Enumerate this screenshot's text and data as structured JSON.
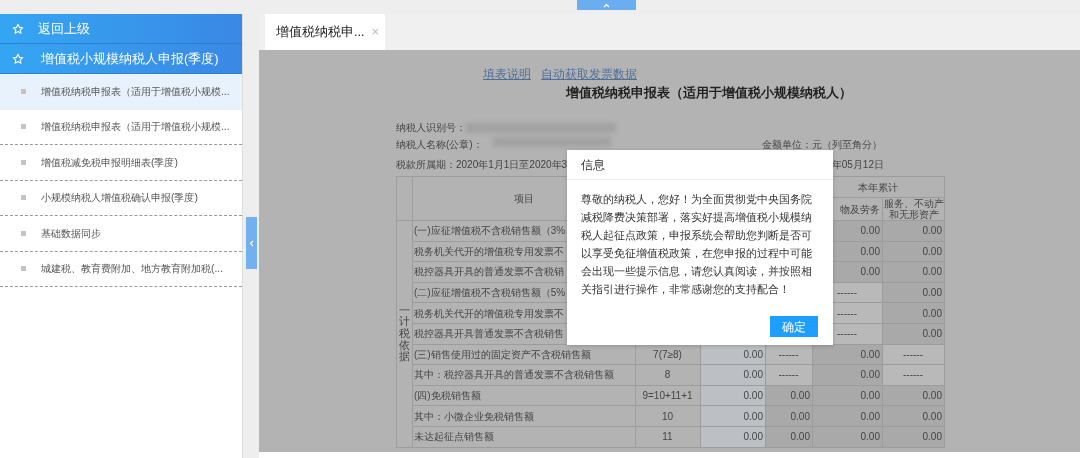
{
  "sidebar": {
    "header_items": [
      {
        "label": "返回上级"
      },
      {
        "label": "增值税小规模纳税人申报(季度)"
      }
    ],
    "items": [
      {
        "label": "增值税纳税申报表（适用于增值税小规模...",
        "selected": true
      },
      {
        "label": "增值税纳税申报表（适用于增值税小规模...",
        "selected": false
      },
      {
        "label": "增值税减免税申报明细表(季度)",
        "selected": false
      },
      {
        "label": "小规模纳税人增值税确认申报(季度)",
        "selected": false
      },
      {
        "label": "基础数据同步",
        "selected": false
      },
      {
        "label": "城建税、教育费附加、地方教育附加税(...",
        "selected": false
      }
    ]
  },
  "tabs": [
    {
      "label": "增值税纳税申...",
      "selected": true,
      "close": "×"
    }
  ],
  "form": {
    "links": [
      "填表说明",
      "自动获取发票数据"
    ],
    "title": "增值税纳税申报表（适用于增值税小规模纳税人）",
    "taxpayer_id_label": "纳税人识别号：",
    "taxpayer_name_label": "纳税人名称(公章)：",
    "amount_unit": "金额单位：元（列至角分）",
    "period": "税款所属期：2020年1月1日至2020年3",
    "fill_date": "年05月12日",
    "table": {
      "item_header": "项目",
      "group_header": "本年累计",
      "column_headers": [
        "物及劳务",
        "服务、不动产和无形资产"
      ],
      "side_label": "一计税依据",
      "rows": [
        {
          "item": "(一)应征增值税不含税销售额（3%",
          "cells": [
            null,
            null,
            "0.00",
            "0.00"
          ]
        },
        {
          "item": "税务机关代开的增值税专用发票不",
          "cells": [
            null,
            null,
            "0.00",
            "0.00"
          ]
        },
        {
          "item": "税控器具开具的普通发票不含税销",
          "cells": [
            null,
            null,
            "0.00",
            "0.00"
          ]
        },
        {
          "item": "(二)应征增值税不含税销售额（5%",
          "cells": [
            null,
            null,
            "------",
            "0.00"
          ]
        },
        {
          "item": "税务机关代开的增值税专用发票不",
          "cells": [
            null,
            null,
            "------",
            "0.00"
          ]
        },
        {
          "item": "税控器具开具普通发票不含税销售",
          "cells": [
            null,
            null,
            "------",
            "0.00"
          ]
        },
        {
          "item": "(三)销售使用过的固定资产不含税销售额",
          "line": "7(7≥8)",
          "cells": [
            "0.00",
            "------",
            "0.00",
            "------"
          ]
        },
        {
          "item": "其中：税控器具开具的普通发票不含税销售额",
          "line": "8",
          "cells": [
            "0.00",
            "------",
            "0.00",
            "------"
          ]
        },
        {
          "item": "(四)免税销售额",
          "line": "9=10+11+1",
          "cells": [
            "0.00",
            "0.00",
            "0.00",
            "0.00"
          ]
        },
        {
          "item": "其中：小微企业免税销售额",
          "line": "10",
          "cells": [
            "0.00",
            "0.00",
            "0.00",
            "0.00"
          ]
        },
        {
          "item": "未达起征点销售额",
          "line": "11",
          "cells": [
            "0.00",
            "0.00",
            "0.00",
            "0.00"
          ]
        }
      ]
    }
  },
  "dialog": {
    "title": "信息",
    "message": "尊敬的纳税人，您好！为全面贯彻党中央国务院减税降费决策部署，落实好提高增值税小规模纳税人起征点政策，申报系统会帮助您判断是否可以享受免征增值税政策，在您申报的过程中可能会出现一些提示信息，请您认真阅读，并按照相关指引进行操作，非常感谢您的支持配合！",
    "button": "确定"
  }
}
